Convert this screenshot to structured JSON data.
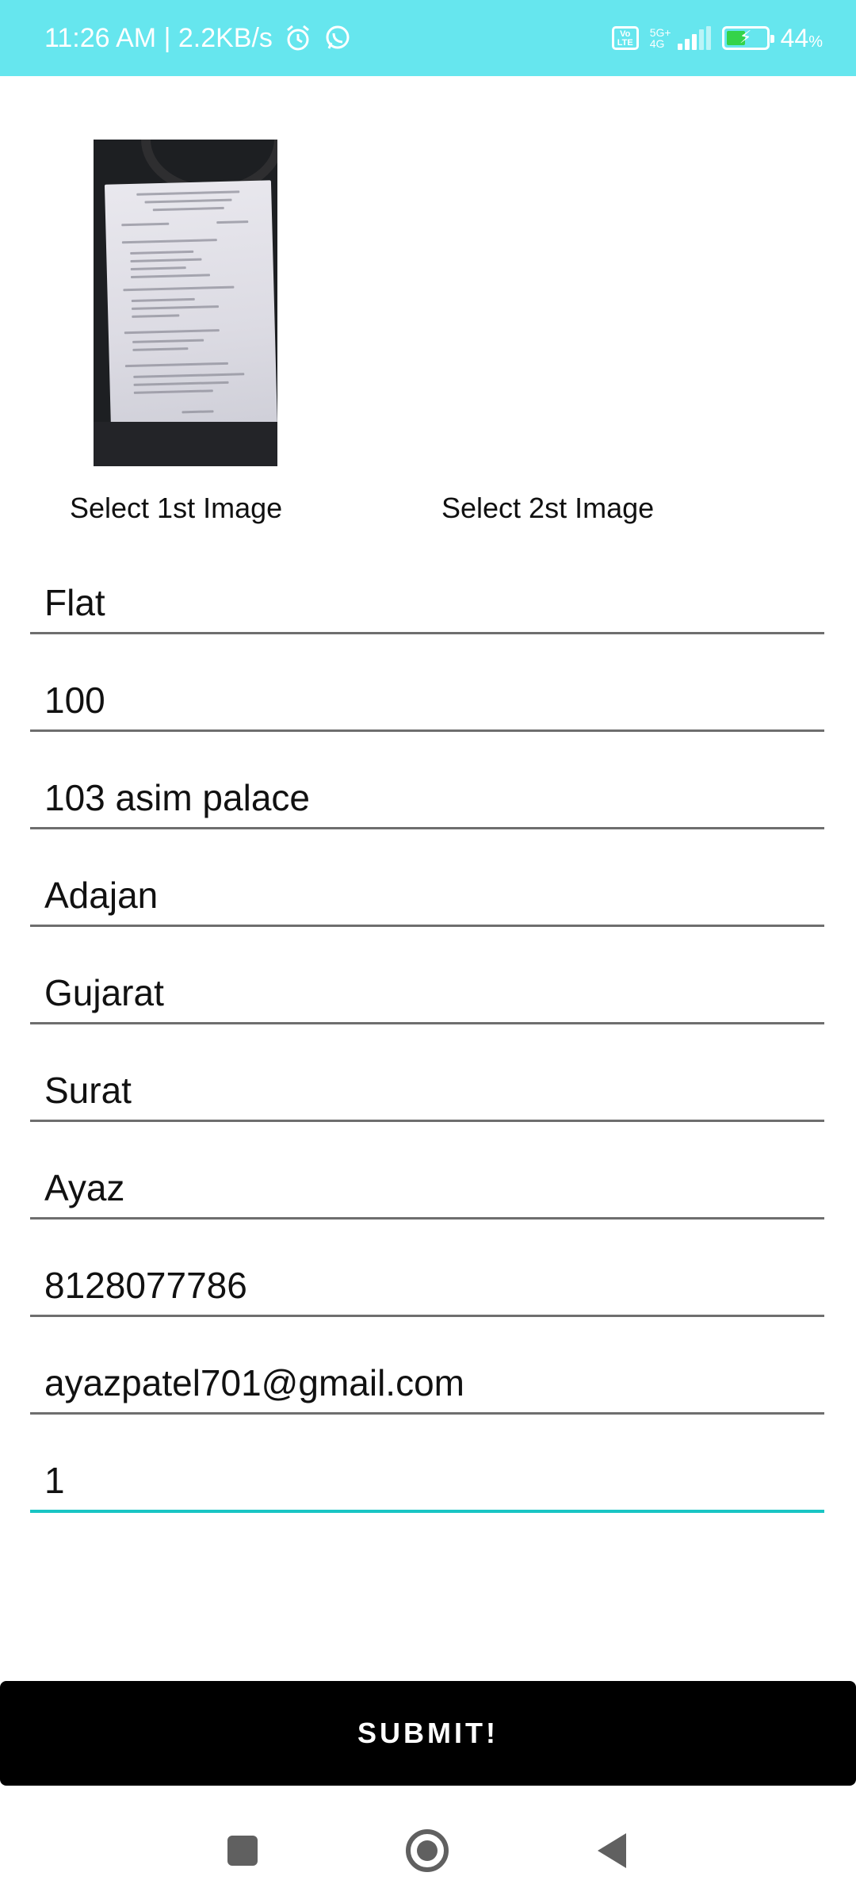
{
  "status_bar": {
    "time_speed": "11:26 AM | 2.2KB/s",
    "alarm_icon": "alarm-clock-icon",
    "whatsapp_icon": "whatsapp-icon",
    "volte": "Vo LTE",
    "network_top": "5G+",
    "network_bottom": "4G",
    "battery_percent": "44",
    "battery_percent_unit": "%",
    "battery_level": 0.44,
    "charging_color": "#34d34a"
  },
  "images": {
    "first_label": "Select 1st Image",
    "second_label": "Select 2st Image"
  },
  "form": {
    "fields": [
      {
        "name": "property-type-field",
        "value": "Flat"
      },
      {
        "name": "area-field",
        "value": "100"
      },
      {
        "name": "address-field",
        "value": "103 asim palace"
      },
      {
        "name": "locality-field",
        "value": "Adajan"
      },
      {
        "name": "state-field",
        "value": "Gujarat"
      },
      {
        "name": "city-field",
        "value": "Surat"
      },
      {
        "name": "name-field",
        "value": "Ayaz"
      },
      {
        "name": "phone-field",
        "value": "8128077786"
      },
      {
        "name": "email-field",
        "value": "ayazpatel701@gmail.com"
      },
      {
        "name": "quantity-field",
        "value": "1"
      }
    ],
    "active_color": "#18c5c4"
  },
  "submit_label": "SUBMIT!",
  "colors": {
    "status_bar_bg": "#66e6ee",
    "submit_bg": "#000000"
  }
}
